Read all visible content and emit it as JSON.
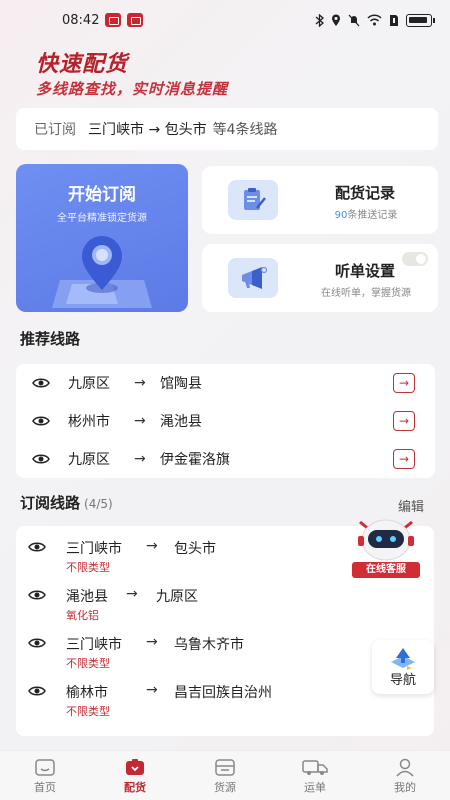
{
  "status_bar": {
    "time": "08:42"
  },
  "hero": {
    "title": "快速配货",
    "subtitle": "多线路查找，实时消息提醒"
  },
  "subscribed_bar": {
    "prefix": "已订阅",
    "route": "三门峡市 → 包头市",
    "suffix": "等4条线路"
  },
  "start_card": {
    "title": "开始订阅",
    "subtitle": "全平台精准锁定货源"
  },
  "cargo_record": {
    "title": "配货记录",
    "count": "90",
    "desc": "条推送记录"
  },
  "listen_settings": {
    "title": "听单设置",
    "desc": "在线听单，掌握货源"
  },
  "recommended": {
    "title": "推荐线路",
    "routes": [
      {
        "from": "九原区",
        "arrow": "→",
        "to": "馆陶县"
      },
      {
        "from": "彬州市",
        "arrow": "→",
        "to": "渑池县"
      },
      {
        "from": "九原区",
        "arrow": "→",
        "to": "伊金霍洛旗"
      }
    ]
  },
  "subscribed": {
    "title": "订阅线路",
    "count": "(4/5)",
    "edit_label": "编辑",
    "routes": [
      {
        "from": "三门峡市",
        "arrow": "→",
        "to": "包头市",
        "type": "不限类型"
      },
      {
        "from": "渑池县",
        "arrow": "→",
        "to": "九原区",
        "type": "氧化铝"
      },
      {
        "from": "三门峡市",
        "arrow": "→",
        "to": "乌鲁木齐市",
        "type": "不限类型"
      },
      {
        "from": "榆林市",
        "arrow": "→",
        "to": "昌吉回族自治州",
        "type": "不限类型"
      }
    ]
  },
  "online_service": {
    "label": "在线客服"
  },
  "navigate": {
    "label": "导航"
  },
  "tabs": [
    {
      "label": "首页",
      "icon": "home-icon"
    },
    {
      "label": "配货",
      "icon": "cargo-icon"
    },
    {
      "label": "货源",
      "icon": "source-icon"
    },
    {
      "label": "运单",
      "icon": "truck-icon"
    },
    {
      "label": "我的",
      "icon": "user-icon"
    }
  ],
  "colors": {
    "accent": "#c22a32",
    "blue": "#5d7ae6"
  }
}
